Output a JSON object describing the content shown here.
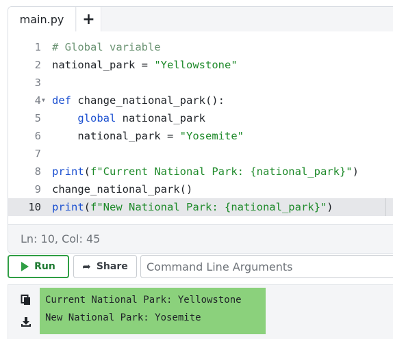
{
  "tabs": {
    "file_name": "main.py",
    "add_label": "+"
  },
  "editor": {
    "lines": [
      {
        "num": "1",
        "tokens": [
          {
            "t": "# Global variable",
            "c": "comment"
          }
        ]
      },
      {
        "num": "2",
        "tokens": [
          {
            "t": "national_park ",
            "c": "plain"
          },
          {
            "t": "=",
            "c": "op"
          },
          {
            "t": " ",
            "c": "plain"
          },
          {
            "t": "\"Yellowstone\"",
            "c": "str"
          }
        ]
      },
      {
        "num": "3",
        "tokens": []
      },
      {
        "num": "4",
        "fold": true,
        "tokens": [
          {
            "t": "def",
            "c": "kw"
          },
          {
            "t": " change_national_park():",
            "c": "plain"
          }
        ]
      },
      {
        "num": "5",
        "tokens": [
          {
            "t": "    ",
            "c": "plain"
          },
          {
            "t": "global",
            "c": "kw"
          },
          {
            "t": " national_park",
            "c": "plain"
          }
        ]
      },
      {
        "num": "6",
        "tokens": [
          {
            "t": "    national_park ",
            "c": "plain"
          },
          {
            "t": "=",
            "c": "op"
          },
          {
            "t": " ",
            "c": "plain"
          },
          {
            "t": "\"Yosemite\"",
            "c": "str"
          }
        ]
      },
      {
        "num": "7",
        "tokens": []
      },
      {
        "num": "8",
        "tokens": [
          {
            "t": "print",
            "c": "kw"
          },
          {
            "t": "(",
            "c": "plain"
          },
          {
            "t": "f\"Current National Park: {national_park}\"",
            "c": "str"
          },
          {
            "t": ")",
            "c": "plain"
          }
        ]
      },
      {
        "num": "9",
        "tokens": [
          {
            "t": "change_national_park()",
            "c": "plain"
          }
        ]
      },
      {
        "num": "10",
        "active": true,
        "tokens": [
          {
            "t": "print",
            "c": "kw"
          },
          {
            "t": "(",
            "c": "plain"
          },
          {
            "t": "f\"New National Park: {national_park}\"",
            "c": "str"
          },
          {
            "t": ")",
            "c": "plain"
          }
        ]
      }
    ]
  },
  "status": {
    "text": "Ln: 10,  Col: 45"
  },
  "toolbar": {
    "run_label": "Run",
    "share_label": "Share",
    "args_placeholder": "Command Line Arguments",
    "args_value": ""
  },
  "output": {
    "lines": [
      "Current National Park: Yellowstone",
      "New National Park: Yosemite"
    ]
  },
  "icons": {
    "run": "play-icon",
    "share": "share-icon",
    "copy": "copy-icon",
    "download": "download-icon",
    "fold": "fold-arrow-icon"
  },
  "colors": {
    "accent": "#2f9e44",
    "output_bg": "#8bd17c",
    "keyword": "#1a4fd0",
    "string": "#1e8a2a",
    "comment": "#6b9373"
  }
}
